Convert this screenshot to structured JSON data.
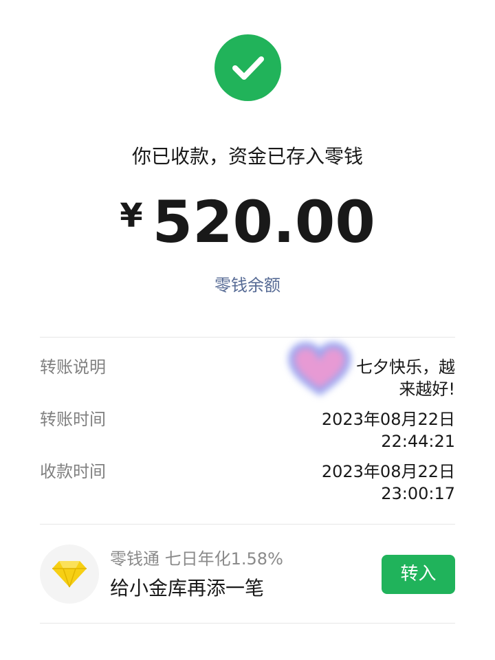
{
  "status": {
    "icon": "checkmark-icon",
    "color": "#21b35a",
    "message": "你已收款，资金已存入零钱"
  },
  "amount": {
    "currency": "¥",
    "value": "520.00"
  },
  "balance_link": "零钱余额",
  "details": [
    {
      "label": "转账说明",
      "value_line1": "七夕快乐，越",
      "value_line2": "来越好!"
    },
    {
      "label": "转账时间",
      "value_line1": "2023年08月22日",
      "value_line2": "22:44:21"
    },
    {
      "label": "收款时间",
      "value_line1": "2023年08月22日",
      "value_line2": "23:00:17"
    }
  ],
  "promo": {
    "icon": "diamond-icon",
    "subtitle": "零钱通 七日年化1.58%",
    "title": "给小金库再添一笔",
    "button_label": "转入",
    "button_color": "#20b35b"
  },
  "colors": {
    "link": "#576b95",
    "label_gray": "#808080",
    "divider": "#e6e6e6"
  }
}
